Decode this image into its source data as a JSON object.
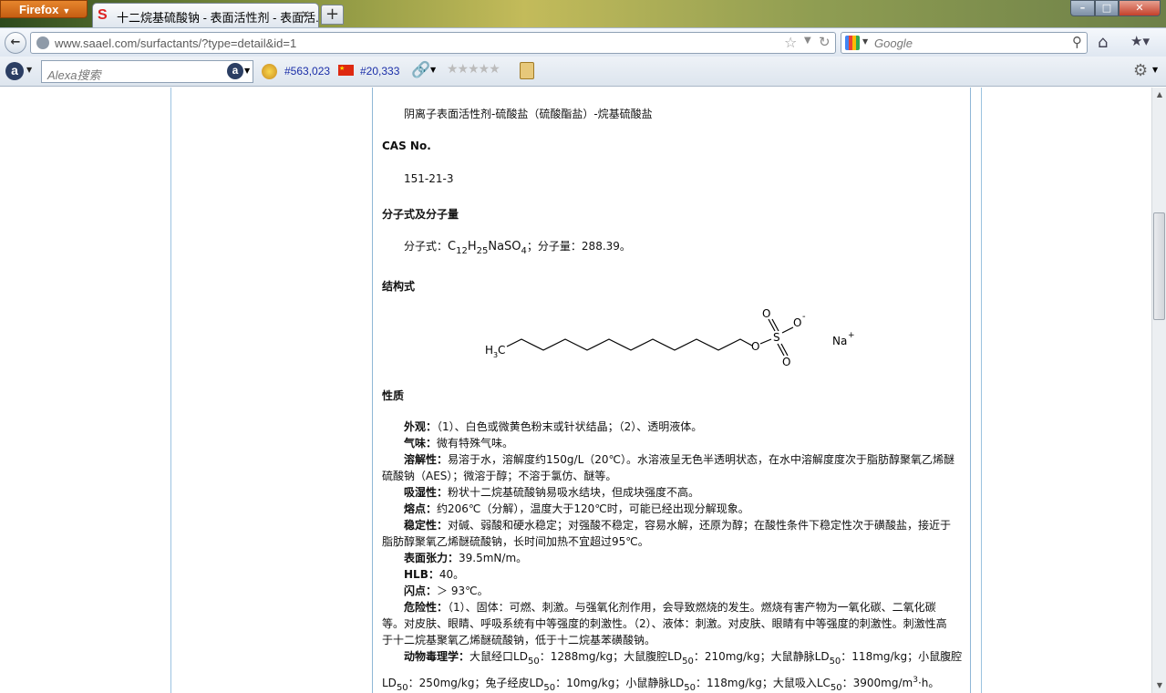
{
  "browser": {
    "menu_button": "Firefox",
    "tab_title": "十二烷基硫酸钠 - 表面活性剂 - 表面活...",
    "tab_favicon": "S",
    "new_tab": "+",
    "url": "www.saael.com/surfactants/?type=detail&id=1",
    "search_placeholder": "Google",
    "window_controls": {
      "minimize": "–",
      "maximize": "□",
      "close": "✕"
    }
  },
  "alexa": {
    "search_placeholder": "Alexa搜索",
    "global_rank": "#563,023",
    "country_rank": "#20,333",
    "rating_stars": "★★★★★",
    "rating_value": 0
  },
  "article": {
    "category_line": "阴离子表面活性剂-硫酸盐（硫酸酯盐）-烷基硫酸盐",
    "cas_heading": "CAS No.",
    "cas_value": "151-21-3",
    "formula_heading": "分子式及分子量",
    "formula": {
      "label": "分子式：",
      "c": "C",
      "c_sub": "12",
      "h": "H",
      "h_sub": "25",
      "rest": "NaSO",
      "o_sub": "4",
      "mw_label": "；分子量：",
      "mw_value": "288.39。"
    },
    "structure_heading": "结构式",
    "structure": {
      "h3c": "H",
      "h3c_sub": "3",
      "h3c_c": "C",
      "o_ester": "O",
      "s": "S",
      "o_top": "O",
      "o_minus": "O",
      "minus": "-",
      "o_bottom": "O",
      "na": "Na",
      "plus": "+"
    },
    "properties_heading": "性质",
    "properties": {
      "appearance_label": "外观：",
      "appearance": "（1）、白色或微黄色粉末或针状结晶；（2）、透明液体。",
      "odor_label": "气味：",
      "odor": "微有特殊气味。",
      "solubility_label": "溶解性：",
      "solubility_1": "易溶于水，溶解度约150g/L（20℃）。水溶液呈无色半透明状态，在水中溶解度度次于脂肪醇聚氧乙烯醚",
      "solubility_2": "硫酸钠（AES）；微溶于醇；不溶于氯仿、醚等。",
      "hygro_label": "吸湿性：",
      "hygro": "粉状十二烷基硫酸钠易吸水结块，但成块强度不高。",
      "mp_label": "熔点：",
      "mp": "约206℃（分解），温度大于120℃时，可能已经出现分解现象。",
      "stability_label": "稳定性：",
      "stability_1": "对碱、弱酸和硬水稳定；对强酸不稳定，容易水解，还原为醇；在酸性条件下稳定性次于磺酸盐，接近于",
      "stability_2": "脂肪醇聚氧乙烯醚硫酸钠，长时间加热不宜超过95℃。",
      "tension_label": "表面张力：",
      "tension": "39.5mN/m。",
      "hlb_label": "HLB：",
      "hlb": "40。",
      "flash_label": "闪点：",
      "flash": "＞ 93℃。",
      "hazard_label": "危险性：",
      "hazard_1": "（1）、固体：可燃、刺激。与强氧化剂作用，会导致燃烧的发生。燃烧有害产物为一氧化碳、二氧化碳",
      "hazard_2": "等。对皮肤、眼睛、呼吸系统有中等强度的刺激性。（2）、液体：刺激。对皮肤、眼睛有中等强度的刺激性。刺激性高",
      "hazard_3": "于十二烷基聚氧乙烯醚硫酸钠，低于十二烷基苯磺酸钠。",
      "tox_label": "动物毒理学：",
      "tox_1a": "大鼠经口LD",
      "tox_1a_sub": "50",
      "tox_1b": "：1288mg/kg；大鼠腹腔LD",
      "tox_1b_sub": "50",
      "tox_1c": "：210mg/kg；大鼠静脉LD",
      "tox_1c_sub": "50",
      "tox_1d": "：118mg/kg；小鼠腹腔",
      "tox_2a": "LD",
      "tox_2a_sub": "50",
      "tox_2b": "：250mg/kg；兔子经皮LD",
      "tox_2b_sub": "50",
      "tox_2c": "：10mg/kg；小鼠静脉LD",
      "tox_2c_sub": "50",
      "tox_2d": "：118mg/kg；大鼠吸入LC",
      "tox_2d_sub": "50",
      "tox_2e": "：3900mg/m",
      "tox_2e_sup": "3",
      "tox_2f": "·h。"
    }
  },
  "scroll": {
    "position_fraction": 0.2
  }
}
